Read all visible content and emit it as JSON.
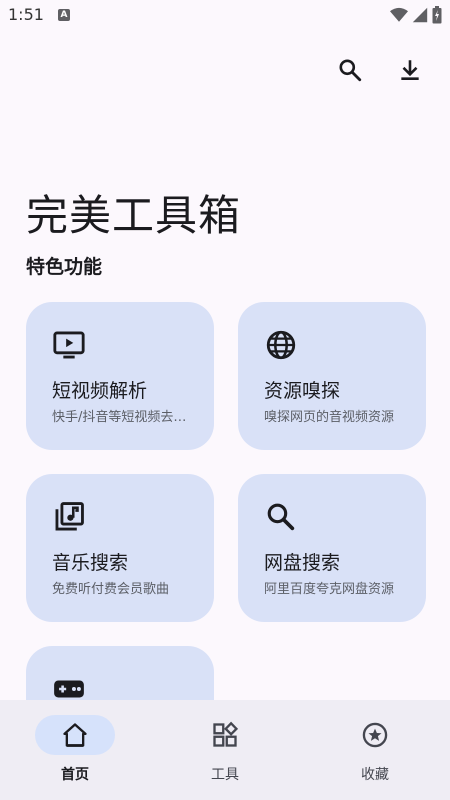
{
  "status_bar": {
    "time": "1:51",
    "notification_letter": "A"
  },
  "app": {
    "title": "完美工具箱",
    "section_title": "特色功能"
  },
  "top_actions": [
    "search-icon",
    "download-icon"
  ],
  "cards": [
    {
      "icon": "tv-play-icon",
      "title": "短视频解析",
      "subtitle": "快手/抖音等短视频去水印"
    },
    {
      "icon": "globe-icon",
      "title": "资源嗅探",
      "subtitle": "嗅探网页的音视频资源"
    },
    {
      "icon": "music-library-icon",
      "title": "音乐搜索",
      "subtitle": "免费听付费会员歌曲"
    },
    {
      "icon": "search-icon",
      "title": "网盘搜索",
      "subtitle": "阿里百度夸克网盘资源"
    },
    {
      "icon": "gamepad-icon",
      "title": "",
      "subtitle": ""
    }
  ],
  "bottom_nav": [
    {
      "icon": "home-icon",
      "label": "首页",
      "active": true
    },
    {
      "icon": "widgets-icon",
      "label": "工具",
      "active": false
    },
    {
      "icon": "star-circle-icon",
      "label": "收藏",
      "active": false
    }
  ],
  "colors": {
    "background": "#fcf8fd",
    "card": "#d9e1f7",
    "nav_bar": "#efedf4",
    "nav_active_pill": "#d6e2fb",
    "text": "#1b1b1f",
    "subtext": "#5b5e66"
  }
}
